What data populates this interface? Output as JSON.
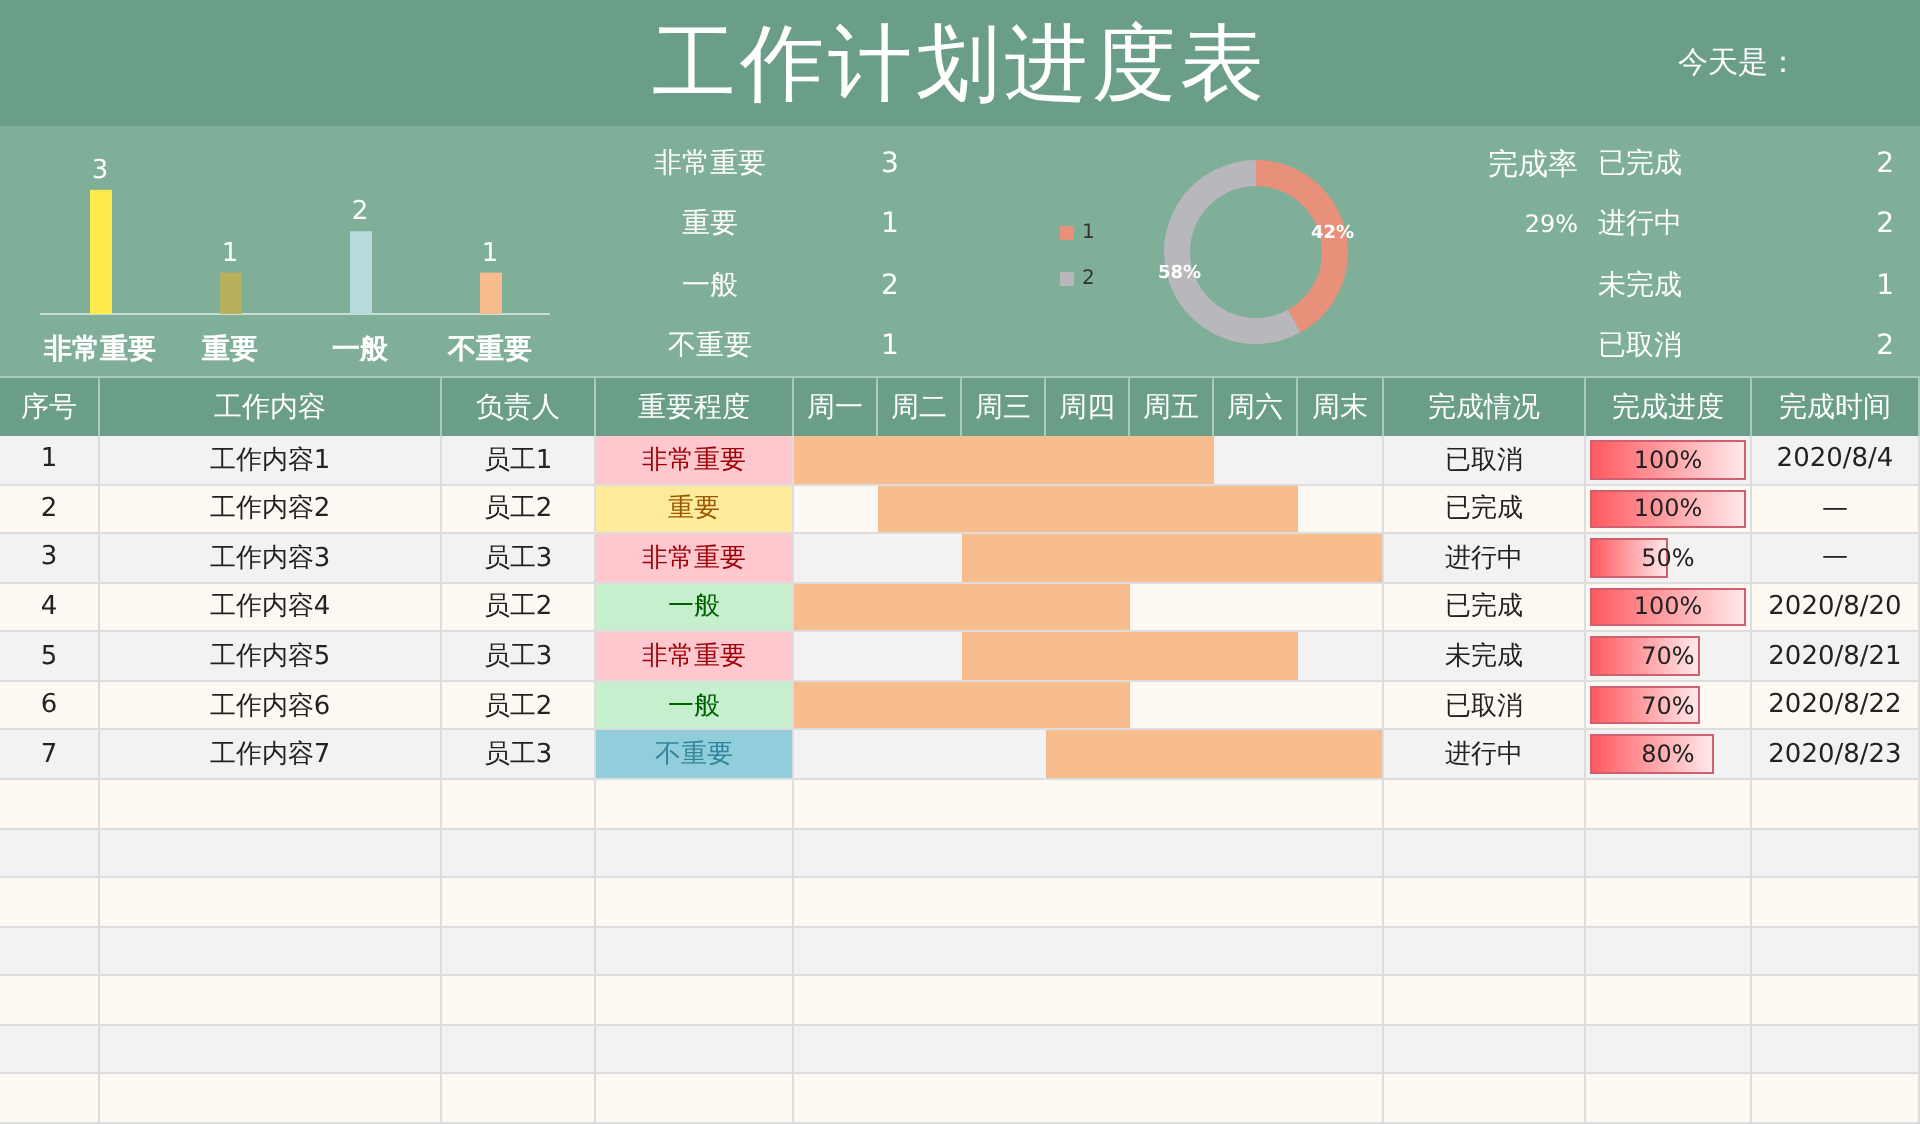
{
  "title": "工作计划进度表",
  "today_label": "今天是：",
  "importance_chart": {
    "chart_data": {
      "type": "bar",
      "categories": [
        "非常重要",
        "重要",
        "一般",
        "不重要"
      ],
      "values": [
        3,
        1,
        2,
        1
      ],
      "data_labels": true
    }
  },
  "importance_summary": [
    {
      "label": "非常重要",
      "count": "3"
    },
    {
      "label": "重要",
      "count": "1"
    },
    {
      "label": "一般",
      "count": "2"
    },
    {
      "label": "不重要",
      "count": "1"
    }
  ],
  "completion_chart": {
    "chart_data": {
      "type": "donut",
      "categories": [
        "1",
        "2"
      ],
      "values": [
        42,
        58
      ],
      "colors": [
        "#e8907a",
        "#b8b8bc"
      ],
      "data_labels": true,
      "value_labels": [
        "42%",
        "58%"
      ]
    }
  },
  "completion_rate": {
    "label": "完成率",
    "value": "29%"
  },
  "status_summary": [
    {
      "label": "已完成",
      "count": "2"
    },
    {
      "label": "进行中",
      "count": "2"
    },
    {
      "label": "未完成",
      "count": "1"
    },
    {
      "label": "已取消",
      "count": "2"
    }
  ],
  "table": {
    "columns": [
      "序号",
      "工作内容",
      "负责人",
      "重要程度",
      "周一",
      "周二",
      "周三",
      "周四",
      "周五",
      "周六",
      "周末",
      "完成情况",
      "完成进度",
      "完成时间"
    ],
    "rows": [
      {
        "no": "1",
        "task": "工作内容1",
        "owner": "员工1",
        "importance": {
          "text": "非常重要",
          "kind": "very_high"
        },
        "days": [
          true,
          true,
          true,
          true,
          true,
          false,
          false
        ],
        "status": "已取消",
        "progress": {
          "text": "100%",
          "level": 1
        },
        "done_time": "2020/8/4"
      },
      {
        "no": "2",
        "task": "工作内容2",
        "owner": "员工2",
        "importance": {
          "text": "重要",
          "kind": "high"
        },
        "days": [
          false,
          true,
          true,
          true,
          true,
          true,
          false
        ],
        "status": "已完成",
        "progress": {
          "text": "100%",
          "level": 1
        },
        "done_time": "—"
      },
      {
        "no": "3",
        "task": "工作内容3",
        "owner": "员工3",
        "importance": {
          "text": "非常重要",
          "kind": "very_high"
        },
        "days": [
          false,
          false,
          true,
          true,
          true,
          true,
          true
        ],
        "status": "进行中",
        "progress": {
          "text": "50%",
          "level": 0.5
        },
        "done_time": "—"
      },
      {
        "no": "4",
        "task": "工作内容4",
        "owner": "员工2",
        "importance": {
          "text": "一般",
          "kind": "normal"
        },
        "days": [
          true,
          true,
          true,
          true,
          false,
          false,
          false
        ],
        "status": "已完成",
        "progress": {
          "text": "100%",
          "level": 1
        },
        "done_time": "2020/8/20"
      },
      {
        "no": "5",
        "task": "工作内容5",
        "owner": "员工3",
        "importance": {
          "text": "非常重要",
          "kind": "very_high"
        },
        "days": [
          false,
          false,
          true,
          true,
          true,
          true,
          false
        ],
        "status": "未完成",
        "progress": {
          "text": "70%",
          "level": 0.7
        },
        "done_time": "2020/8/21"
      },
      {
        "no": "6",
        "task": "工作内容6",
        "owner": "员工2",
        "importance": {
          "text": "一般",
          "kind": "normal"
        },
        "days": [
          true,
          true,
          true,
          true,
          false,
          false,
          false
        ],
        "status": "已取消",
        "progress": {
          "text": "70%",
          "level": 0.7
        },
        "done_time": "2020/8/22"
      },
      {
        "no": "7",
        "task": "工作内容7",
        "owner": "员工3",
        "importance": {
          "text": "不重要",
          "kind": "low"
        },
        "days": [
          false,
          false,
          false,
          true,
          true,
          true,
          true
        ],
        "status": "进行中",
        "progress": {
          "text": "80%",
          "level": 0.8
        },
        "done_time": "2020/8/23"
      }
    ]
  }
}
